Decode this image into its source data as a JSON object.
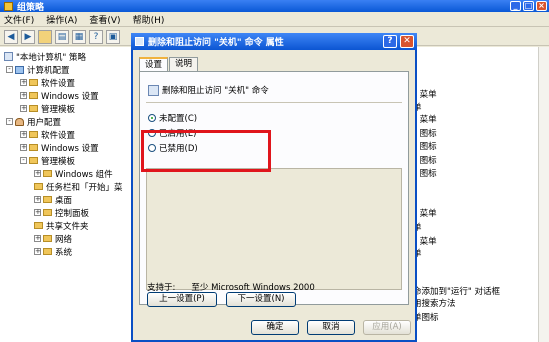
{
  "window": {
    "title": "组策略"
  },
  "menu": [
    "文件(F)",
    "操作(A)",
    "查看(V)",
    "帮助(H)"
  ],
  "tree": [
    {
      "label": "\"本地计算机\" 策略",
      "icon": "policy-icon",
      "level": 0,
      "expander": ""
    },
    {
      "label": "计算机配置",
      "icon": "computer-icon",
      "level": 1,
      "expander": "-"
    },
    {
      "label": "软件设置",
      "icon": "folder-icon",
      "level": 2,
      "expander": "+"
    },
    {
      "label": "Windows 设置",
      "icon": "folder-icon",
      "level": 2,
      "expander": "+"
    },
    {
      "label": "管理模板",
      "icon": "folder-icon",
      "level": 2,
      "expander": "+"
    },
    {
      "label": "用户配置",
      "icon": "user-icon",
      "level": 1,
      "expander": "-"
    },
    {
      "label": "软件设置",
      "icon": "folder-icon",
      "level": 2,
      "expander": "+"
    },
    {
      "label": "Windows 设置",
      "icon": "folder-icon",
      "level": 2,
      "expander": "+"
    },
    {
      "label": "管理模板",
      "icon": "folder-icon",
      "level": 2,
      "expander": "-"
    },
    {
      "label": "Windows 组件",
      "icon": "folder-icon",
      "level": 3,
      "expander": "+"
    },
    {
      "label": "任务栏和「开始」菜",
      "icon": "folder-icon",
      "level": 3,
      "expander": ""
    },
    {
      "label": "桌面",
      "icon": "folder-icon",
      "level": 3,
      "expander": "+"
    },
    {
      "label": "控制面板",
      "icon": "folder-icon",
      "level": 3,
      "expander": "+"
    },
    {
      "label": "共享文件夹",
      "icon": "folder-icon",
      "level": 3,
      "expander": ""
    },
    {
      "label": "网络",
      "icon": "folder-icon",
      "level": 3,
      "expander": "+"
    },
    {
      "label": "系统",
      "icon": "folder-icon",
      "level": 3,
      "expander": "+"
    }
  ],
  "right_pane": {
    "rows": [
      "\" 菜单",
      "单",
      "\" 菜单",
      "\" 图标",
      "\" 图标",
      "\" 图标",
      "\" 图标",
      "\" 菜单",
      "单",
      "\" 菜单",
      "单",
      "命添加到\"运行\" 对话框",
      "用搜索方法",
      "单图标"
    ]
  },
  "dialog": {
    "title": "删除和阻止访问 \"关机\" 命令 属性",
    "help_label": "?",
    "close_label": "✕",
    "tabs": [
      {
        "label": "设置",
        "active": true
      },
      {
        "label": "说明",
        "active": false
      }
    ],
    "policy_name": "删除和阻止访问 \"关机\" 命令",
    "options": [
      {
        "label": "未配置(C)",
        "checked": true
      },
      {
        "label": "已启用(E)",
        "checked": false
      },
      {
        "label": "已禁用(D)",
        "checked": false
      }
    ],
    "supported_label": "支持于:",
    "supported_value": "至少 Microsoft Windows 2000",
    "prev_button": "上一设置(P)",
    "next_button": "下一设置(N)",
    "ok_button": "确定",
    "cancel_button": "取消",
    "apply_button": "应用(A)"
  }
}
